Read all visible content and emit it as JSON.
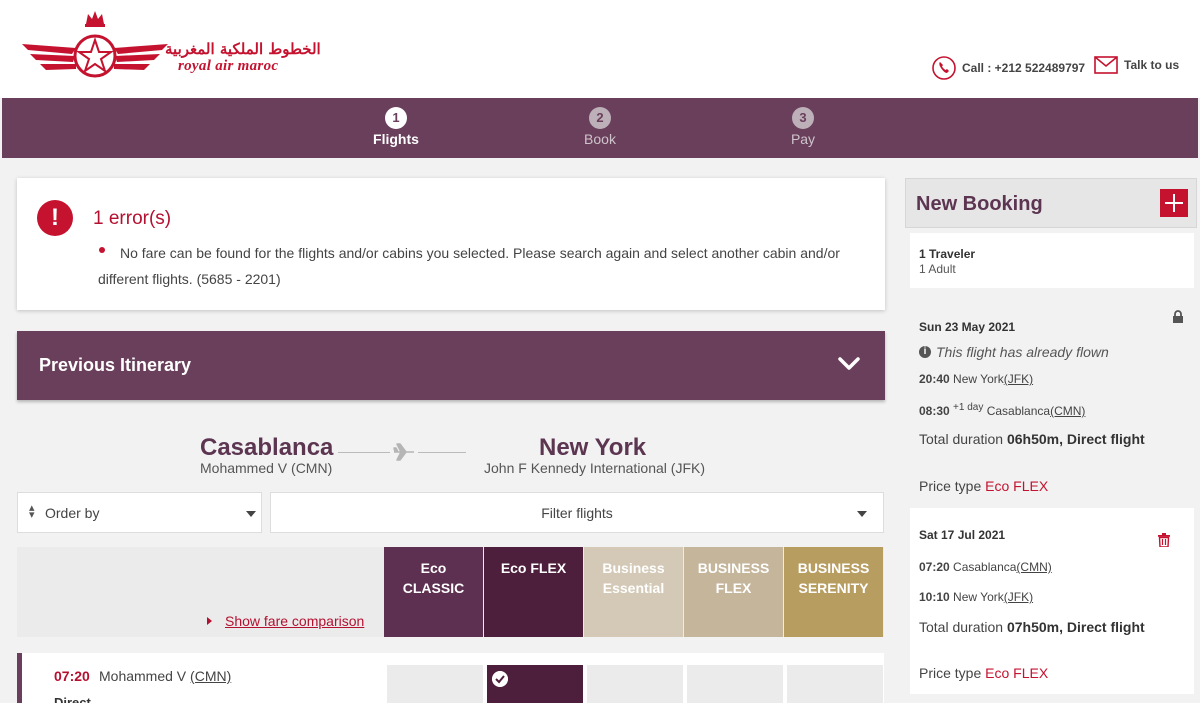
{
  "brand": {
    "name_ar": "الخطوط الملكية المغربية",
    "name_en": "royal air maroc",
    "color": "#c4122f"
  },
  "header": {
    "call_label": "Call : +212 522489797",
    "talk_label": "Talk to us"
  },
  "steps": [
    {
      "num": "1",
      "label": "Flights",
      "active": true
    },
    {
      "num": "2",
      "label": "Book",
      "active": false
    },
    {
      "num": "3",
      "label": "Pay",
      "active": false
    }
  ],
  "error": {
    "icon": "!",
    "title": "1 error(s)",
    "message": "No fare can be found for the flights and/or cabins you selected. Please search again and select another cabin and/or different flights. (5685 - 2201)"
  },
  "previous_itinerary": {
    "title": "Previous Itinerary"
  },
  "route": {
    "from_city": "Casablanca",
    "from_airport": "Mohammed V (CMN)",
    "to_city": "New York",
    "to_airport": "John F Kennedy International (JFK)"
  },
  "filters": {
    "order_by": "Order by",
    "filter_flights": "Filter flights"
  },
  "fares": {
    "show_comparison": "Show fare comparison",
    "columns": [
      {
        "line1": "Eco",
        "line2": "CLASSIC",
        "color": "#5d2f50"
      },
      {
        "line1": "Eco FLEX",
        "line2": "",
        "color": "#4e1f3d"
      },
      {
        "line1": "Business",
        "line2": "Essential",
        "color": "#d4c9b6"
      },
      {
        "line1": "BUSINESS",
        "line2": "FLEX",
        "color": "#c4b59b"
      },
      {
        "line1": "BUSINESS",
        "line2": "SERENITY",
        "color": "#b89d61"
      }
    ]
  },
  "flight": {
    "time": "07:20",
    "airport": "Mohammed V",
    "code": "(CMN)",
    "type": "Direct"
  },
  "sidebar": {
    "title": "New Booking",
    "travelers": "1 Traveler",
    "adults": "1 Adult",
    "segments": [
      {
        "date": "Sun 23 May 2021",
        "flown_note": "This flight has already flown",
        "dep_time": "20:40",
        "dep_city": "New York",
        "dep_code": "(JFK)",
        "arr_time": "08:30",
        "arr_day": "+1 day",
        "arr_city": "Casablanca",
        "arr_code": "(CMN)",
        "duration_label": "Total duration",
        "duration_value": "06h50m, Direct flight",
        "price_label": "Price type",
        "price_value": "Eco FLEX"
      },
      {
        "date": "Sat 17 Jul 2021",
        "dep_time": "07:20",
        "dep_city": "Casablanca",
        "dep_code": "(CMN)",
        "arr_time": "10:10",
        "arr_city": "New York",
        "arr_code": "(JFK)",
        "duration_label": "Total duration",
        "duration_value": "07h50m, Direct flight",
        "price_label": "Price type",
        "price_value": "Eco FLEX"
      }
    ]
  },
  "colors": {
    "primary": "#6a3f5c",
    "accent": "#c4122f",
    "background": "#f2f2f2"
  }
}
